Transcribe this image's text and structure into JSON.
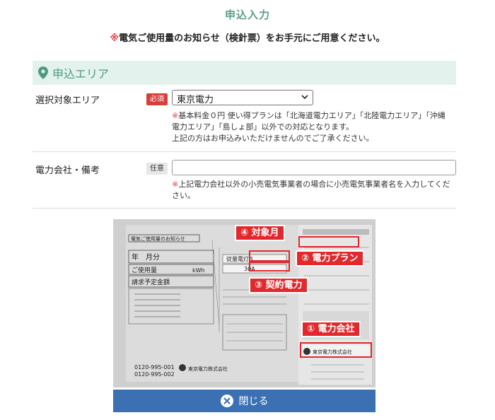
{
  "page": {
    "title": "申込入力",
    "notice_mark": "※",
    "notice_text": "電気ご使用量のお知らせ（検針票）をお手元にご用意ください。"
  },
  "section": {
    "title": "申込エリア"
  },
  "area": {
    "label": "選択対象エリア",
    "badge": "必須",
    "selected": "東京電力",
    "note_mark": "※",
    "note_line1": "基本料金０円 使い得プランは「北海道電力エリア」「北陸電力エリア」「沖縄",
    "note_line2": "電力エリア」「島しょ部」以外での対応となります。",
    "note_line3": "上記の方はお申込みいただけませんのでご了承ください。"
  },
  "company": {
    "label": "電力会社・備考",
    "badge": "任意",
    "value": "",
    "note_mark": "※",
    "note_line1": "上記電力会社以外の小売電気事業者の場合に小売電気事業者名を入力してくだ",
    "note_line2": "さい。"
  },
  "figure": {
    "callout_month": "④ 対象月",
    "callout_plan": "② 電力プラン",
    "callout_contract": "③ 契約電力",
    "callout_company": "① 電力会社",
    "doc_header": "電気ご使用量のお知らせ",
    "doc_month": "年　月分",
    "doc_usage": "ご使用量",
    "doc_kwh": "kWh",
    "doc_bill": "請求予定金額",
    "doc_plan": "従量電灯B",
    "doc_amp": "30A",
    "doc_tel1": "0120-995-001",
    "doc_tel2": "0120-995-002",
    "doc_company": "東京電力株式会社",
    "doc_company2": "東京電力株式会社"
  },
  "buttons": {
    "close": "閉じる"
  }
}
